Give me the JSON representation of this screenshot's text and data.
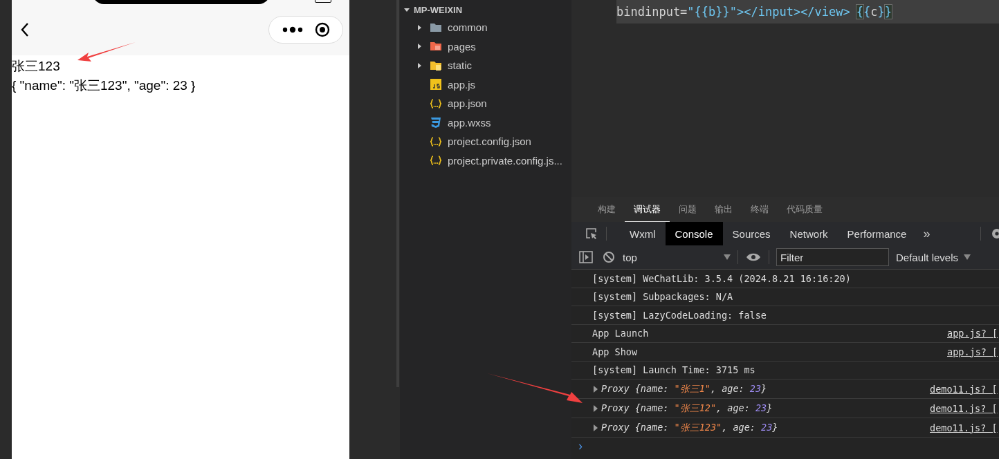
{
  "phone": {
    "lines": [
      "张三123",
      "{ \"name\": \"张三123\", \"age\": 23 }"
    ]
  },
  "explorer": {
    "root": "MP-WEIXIN",
    "expanded": true,
    "items": [
      {
        "label": "common",
        "kind": "folder",
        "expanded": false
      },
      {
        "label": "pages",
        "kind": "pages-folder",
        "expanded": false
      },
      {
        "label": "static",
        "kind": "assets-folder",
        "expanded": false
      },
      {
        "label": "app.js",
        "kind": "js"
      },
      {
        "label": "app.json",
        "kind": "json"
      },
      {
        "label": "app.wxss",
        "kind": "css"
      },
      {
        "label": "project.config.json",
        "kind": "json"
      },
      {
        "label": "project.private.config.js...",
        "kind": "json"
      }
    ]
  },
  "editor": {
    "tokens": [
      {
        "text": "bindinput=",
        "kind": "attr"
      },
      {
        "text": "\"{{b}}\"",
        "kind": "string"
      },
      {
        "text": "></input></view>",
        "kind": "tag"
      },
      {
        "text": "{",
        "kind": "match"
      },
      {
        "text": "{",
        "kind": "string"
      },
      {
        "text": "c",
        "kind": "attr"
      },
      {
        "text": "}",
        "kind": "string"
      },
      {
        "text": "}",
        "kind": "match"
      }
    ]
  },
  "panel_tabs": [
    {
      "label": "构建",
      "selected": false
    },
    {
      "label": "调试器",
      "selected": true
    },
    {
      "label": "问题",
      "selected": false
    },
    {
      "label": "输出",
      "selected": false
    },
    {
      "label": "终端",
      "selected": false
    },
    {
      "label": "代码质量",
      "selected": false
    }
  ],
  "devtools_tabs": [
    {
      "label": "Wxml",
      "selected": false
    },
    {
      "label": "Console",
      "selected": true
    },
    {
      "label": "Sources",
      "selected": false
    },
    {
      "label": "Network",
      "selected": false
    },
    {
      "label": "Performance",
      "selected": false
    }
  ],
  "more_tabs": "»",
  "console_toolbar": {
    "context": "top",
    "filter_placeholder": "Filter",
    "levels": "Default levels"
  },
  "console_rows": [
    {
      "kind": "log",
      "parts": [
        {
          "text": "[system] WeChatLib: 3.5.4 (2024.8.21 16:16:20)",
          "kind": "plain"
        }
      ]
    },
    {
      "kind": "log",
      "parts": [
        {
          "text": "[system] Subpackages: N/A",
          "kind": "plain"
        }
      ]
    },
    {
      "kind": "log",
      "parts": [
        {
          "text": "[system] LazyCodeLoading: false",
          "kind": "plain"
        }
      ]
    },
    {
      "kind": "log",
      "parts": [
        {
          "text": "App Launch",
          "kind": "plain"
        }
      ],
      "source": "app.js? ["
    },
    {
      "kind": "log",
      "parts": [
        {
          "text": "App Show",
          "kind": "plain"
        }
      ],
      "source": "app.js? ["
    },
    {
      "kind": "log",
      "parts": [
        {
          "text": "[system] Launch Time: 3715 ms",
          "kind": "plain"
        }
      ]
    },
    {
      "kind": "object",
      "parts": [
        {
          "text": "Proxy",
          "kind": "plain"
        },
        {
          "text": "{name: ",
          "kind": "key"
        },
        {
          "text": "\"张三1\"",
          "kind": "string"
        },
        {
          "text": ", age: ",
          "kind": "key"
        },
        {
          "text": "23",
          "kind": "number"
        },
        {
          "text": "}",
          "kind": "key"
        }
      ],
      "source": "demo11.js? ["
    },
    {
      "kind": "object",
      "parts": [
        {
          "text": "Proxy",
          "kind": "plain"
        },
        {
          "text": "{name: ",
          "kind": "key"
        },
        {
          "text": "\"张三12\"",
          "kind": "string"
        },
        {
          "text": ", age: ",
          "kind": "key"
        },
        {
          "text": "23",
          "kind": "number"
        },
        {
          "text": "}",
          "kind": "key"
        }
      ],
      "source": "demo11.js? ["
    },
    {
      "kind": "object",
      "parts": [
        {
          "text": "Proxy",
          "kind": "plain"
        },
        {
          "text": "{name: ",
          "kind": "key"
        },
        {
          "text": "\"张三123\"",
          "kind": "string"
        },
        {
          "text": ", age: ",
          "kind": "key"
        },
        {
          "text": "23",
          "kind": "number"
        },
        {
          "text": "}",
          "kind": "key"
        }
      ],
      "source": "demo11.js? ["
    }
  ],
  "prompt": "›"
}
